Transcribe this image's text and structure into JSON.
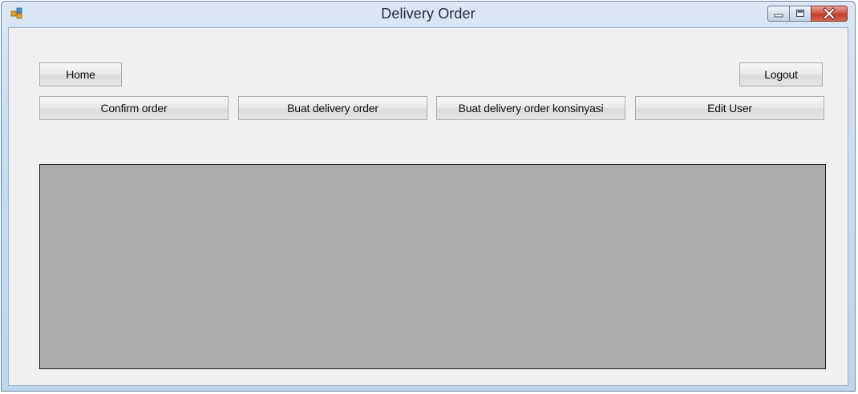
{
  "window": {
    "title": "Delivery Order"
  },
  "buttons": {
    "home": "Home",
    "logout": "Logout",
    "confirm_order": "Confirm order",
    "buat_delivery_order": "Buat delivery order",
    "buat_delivery_order_konsinyasi": "Buat delivery order konsinyasi",
    "edit_user": "Edit User"
  },
  "icons": {
    "app": "app-window-icon",
    "minimize": "minimize-icon",
    "maximize": "maximize-icon",
    "close": "close-icon"
  },
  "colors": {
    "panel": "#ababab",
    "client": "#f0f0f0",
    "close_button": "#c94a3b"
  }
}
